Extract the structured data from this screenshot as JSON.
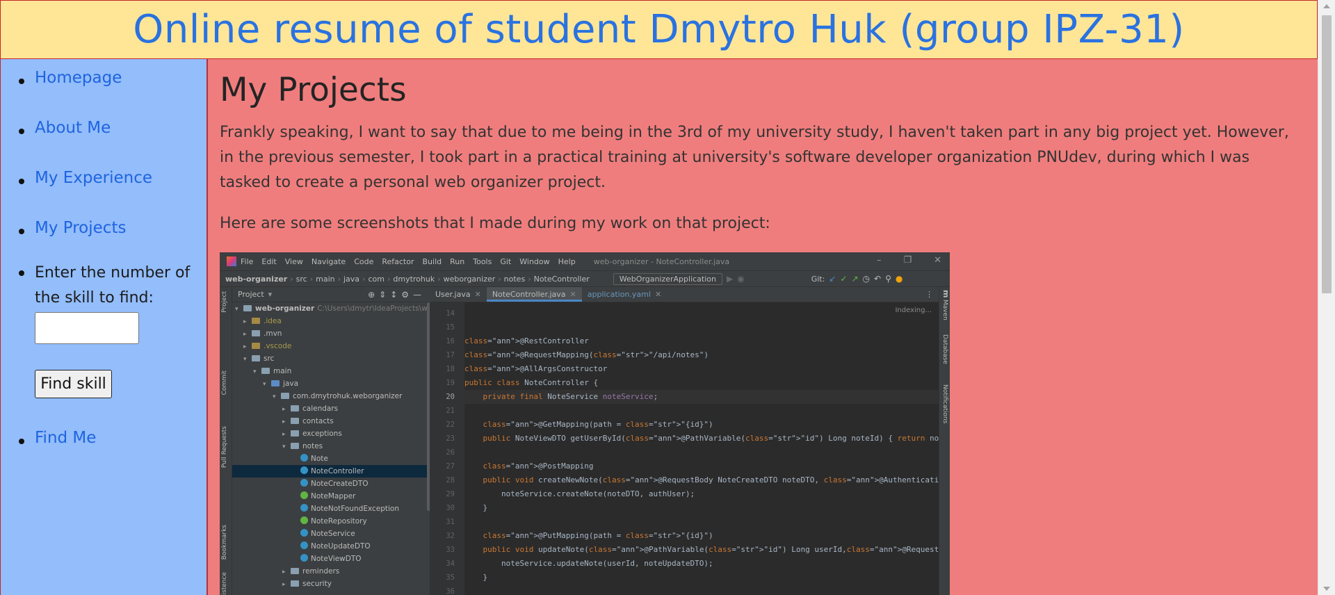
{
  "header": {
    "title": "Online resume of student Dmytro Huk (group IPZ-31)"
  },
  "sidebar": {
    "items": [
      {
        "label": "Homepage"
      },
      {
        "label": "About Me"
      },
      {
        "label": "My Experience"
      },
      {
        "label": "My Projects"
      }
    ],
    "skill_prompt": "Enter the number of the skill to find:",
    "skill_input_value": "",
    "find_button_label": "Find skill",
    "find_me_label": "Find Me"
  },
  "main": {
    "heading": "My Projects",
    "paragraph1": "Frankly speaking, I want to say that due to me being in the 3rd of my university study, I haven't taken part in any big project yet. However, in the previous semester, I took part in a practical training at university's software developer organization PNUdev, during which I was tasked to create a personal web organizer project.",
    "paragraph2": "Here are some screenshots that I made during my work on that project:"
  },
  "ide": {
    "menu": [
      "File",
      "Edit",
      "View",
      "Navigate",
      "Code",
      "Refactor",
      "Build",
      "Run",
      "Tools",
      "Git",
      "Window",
      "Help"
    ],
    "window_title": "web-organizer - NoteController.java",
    "breadcrumbs": [
      "web-organizer",
      "src",
      "main",
      "java",
      "com",
      "dmytrohuk",
      "weborganizer",
      "notes",
      "NoteController"
    ],
    "run_config": "WebOrganizerApplication",
    "git_label": "Git:",
    "left_strip": [
      "Project",
      "Commit",
      "Pull Requests",
      "Bookmarks",
      "Persistence"
    ],
    "right_strip": [
      "Maven",
      "Database",
      "Notifications"
    ],
    "project_label": "Project",
    "tabs": [
      {
        "label": "User.java",
        "active": false
      },
      {
        "label": "NoteController.java",
        "active": true
      },
      {
        "label": "application.yaml",
        "active": false
      }
    ],
    "indexing": "Indexing...",
    "tree": [
      {
        "label": "web-organizer",
        "extra": "C:\\Users\\dmytr\\IdeaProjects\\web-organiz",
        "type": "root"
      },
      {
        "label": ".idea",
        "type": "folder-olive"
      },
      {
        "label": ".mvn",
        "type": "folder"
      },
      {
        "label": ".vscode",
        "type": "folder-olive"
      },
      {
        "label": "src",
        "type": "folder"
      },
      {
        "label": "main",
        "type": "folder"
      },
      {
        "label": "java",
        "type": "folder-blue"
      },
      {
        "label": "com.dmytrohuk.weborganizer",
        "type": "folder"
      },
      {
        "label": "calendars",
        "type": "folder"
      },
      {
        "label": "contacts",
        "type": "folder"
      },
      {
        "label": "exceptions",
        "type": "folder"
      },
      {
        "label": "notes",
        "type": "folder"
      },
      {
        "label": "Note",
        "type": "class"
      },
      {
        "label": "NoteController",
        "type": "class"
      },
      {
        "label": "NoteCreateDTO",
        "type": "class"
      },
      {
        "label": "NoteMapper",
        "type": "interface"
      },
      {
        "label": "NoteNotFoundException",
        "type": "class"
      },
      {
        "label": "NoteRepository",
        "type": "interface"
      },
      {
        "label": "NoteService",
        "type": "class"
      },
      {
        "label": "NoteUpdateDTO",
        "type": "class"
      },
      {
        "label": "NoteViewDTO",
        "type": "class"
      },
      {
        "label": "reminders",
        "type": "folder"
      },
      {
        "label": "security",
        "type": "folder"
      }
    ],
    "line_numbers": [
      "14",
      "15",
      "16",
      "17",
      "18",
      "19",
      "20",
      "21",
      "22",
      "23",
      "26",
      "27",
      "28",
      "29",
      "30",
      "31",
      "32",
      "33",
      "34",
      "35",
      "36"
    ],
    "current_line": "20",
    "code": [
      "",
      "",
      "@RestController",
      "@RequestMapping(\"/api/notes\")",
      "@AllArgsConstructor",
      "public class NoteController {",
      "    private final NoteService noteService;",
      "",
      "    @GetMapping(path = \"{id}\")",
      "    public NoteViewDTO getUserById(@PathVariable(\"id\") Long noteId) { return noteService.viewNote(noteId",
      "",
      "    @PostMapping",
      "    public void createNewNote(@RequestBody NoteCreateDTO noteDTO, @AuthenticationPrincipal AuthUser auth",
      "        noteService.createNote(noteDTO, authUser);",
      "    }",
      "",
      "    @PutMapping(path = \"{id}\")",
      "    public void updateNote(@PathVariable(\"id\") Long userId,@RequestBody NoteUpdateDTO noteUpdateDTO){",
      "        noteService.updateNote(userId, noteUpdateDTO);",
      "    }",
      ""
    ]
  }
}
